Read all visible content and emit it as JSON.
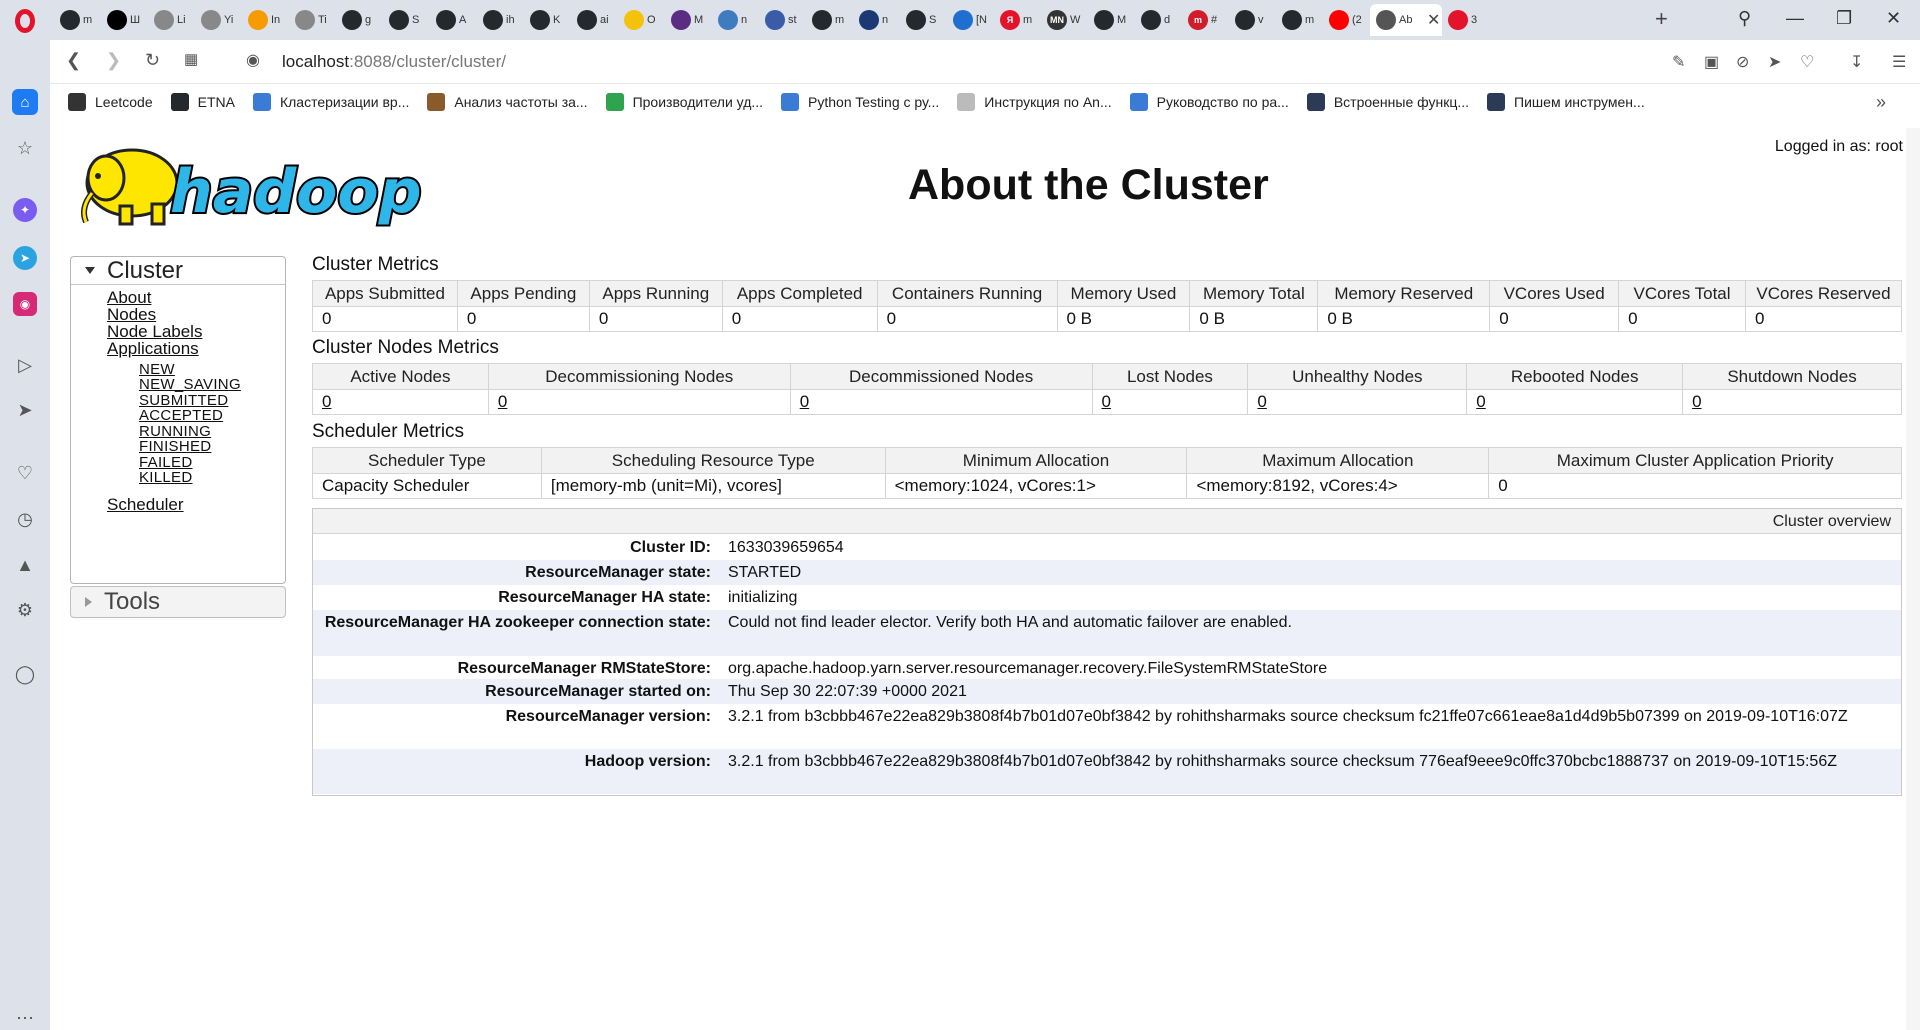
{
  "browser": {
    "tabs": [
      {
        "label": "m",
        "color": "#24292e",
        "glyph": ""
      },
      {
        "label": "Ш",
        "color": "#000000",
        "glyph": ""
      },
      {
        "label": "Li",
        "color": "#888888",
        "glyph": ""
      },
      {
        "label": "Yi",
        "color": "#888888",
        "glyph": ""
      },
      {
        "label": "In",
        "color": "#f59d00",
        "glyph": ""
      },
      {
        "label": "Ti",
        "color": "#888888",
        "glyph": ""
      },
      {
        "label": "g",
        "color": "#24292e",
        "glyph": ""
      },
      {
        "label": "S",
        "color": "#24292e",
        "glyph": ""
      },
      {
        "label": "A",
        "color": "#24292e",
        "glyph": ""
      },
      {
        "label": "ih",
        "color": "#24292e",
        "glyph": ""
      },
      {
        "label": "K",
        "color": "#24292e",
        "glyph": ""
      },
      {
        "label": "ai",
        "color": "#24292e",
        "glyph": ""
      },
      {
        "label": "O",
        "color": "#f4c20d",
        "glyph": ""
      },
      {
        "label": "M",
        "color": "#5b2d82",
        "glyph": ""
      },
      {
        "label": "n",
        "color": "#3f7cbf",
        "glyph": ""
      },
      {
        "label": "st",
        "color": "#3a5ca8",
        "glyph": ""
      },
      {
        "label": "m",
        "color": "#24292e",
        "glyph": ""
      },
      {
        "label": "n",
        "color": "#1b3a73",
        "glyph": ""
      },
      {
        "label": "S",
        "color": "#24292e",
        "glyph": ""
      },
      {
        "label": "[N",
        "color": "#1f6fd1",
        "glyph": ""
      },
      {
        "label": "m",
        "color": "#e3132b",
        "glyph": "Я"
      },
      {
        "label": "W",
        "color": "#333333",
        "glyph": "MN"
      },
      {
        "label": "M",
        "color": "#24292e",
        "glyph": ""
      },
      {
        "label": "d",
        "color": "#24292e",
        "glyph": ""
      },
      {
        "label": "#",
        "color": "#d31c2b",
        "glyph": "m"
      },
      {
        "label": "v",
        "color": "#24292e",
        "glyph": ""
      },
      {
        "label": "m",
        "color": "#24292e",
        "glyph": ""
      },
      {
        "label": "(2",
        "color": "#ff0000",
        "glyph": ""
      }
    ],
    "active_tab": {
      "label": "Ab",
      "color": "#555555"
    },
    "extra_tab": {
      "label": "3",
      "color": "#e3132b"
    },
    "url_host": "localhost",
    "url_path": ":8088/cluster/cluster/",
    "bookmarks": [
      {
        "label": "Leetcode",
        "color": "#333333"
      },
      {
        "label": "ETNA",
        "color": "#24292e"
      },
      {
        "label": "Кластеризации вр...",
        "color": "#3a7bd5"
      },
      {
        "label": "Анализ частоты за...",
        "color": "#8a5a2b"
      },
      {
        "label": "Производители уд...",
        "color": "#2ea44f"
      },
      {
        "label": "Python Testing с ру...",
        "color": "#3a7bd5"
      },
      {
        "label": "Инструкция по An...",
        "color": "#bbbbbb"
      },
      {
        "label": "Руководство по ра...",
        "color": "#3a7bd5"
      },
      {
        "label": "Встроенные функц...",
        "color": "#2b3a55"
      },
      {
        "label": "Пишем инструмен...",
        "color": "#2b3a55"
      }
    ]
  },
  "page": {
    "title": "About the Cluster",
    "logo_text": "hadoop",
    "logged_in": "Logged in as: root",
    "nav": {
      "cluster_header": "Cluster",
      "links": [
        "About",
        "Nodes",
        "Node Labels",
        "Applications"
      ],
      "app_states": [
        "NEW",
        "NEW_SAVING",
        "SUBMITTED",
        "ACCEPTED",
        "RUNNING",
        "FINISHED",
        "FAILED",
        "KILLED"
      ],
      "scheduler": "Scheduler",
      "tools_header": "Tools"
    },
    "cluster_metrics": {
      "title": "Cluster Metrics",
      "headers": [
        "Apps Submitted",
        "Apps Pending",
        "Apps Running",
        "Apps Completed",
        "Containers Running",
        "Memory Used",
        "Memory Total",
        "Memory Reserved",
        "VCores Used",
        "VCores Total",
        "VCores Reserved"
      ],
      "values": [
        "0",
        "0",
        "0",
        "0",
        "0",
        "0 B",
        "0 B",
        "0 B",
        "0",
        "0",
        "0"
      ]
    },
    "node_metrics": {
      "title": "Cluster Nodes Metrics",
      "headers": [
        "Active Nodes",
        "Decommissioning Nodes",
        "Decommissioned Nodes",
        "Lost Nodes",
        "Unhealthy Nodes",
        "Rebooted Nodes",
        "Shutdown Nodes"
      ],
      "values": [
        "0",
        "0",
        "0",
        "0",
        "0",
        "0",
        "0"
      ]
    },
    "scheduler_metrics": {
      "title": "Scheduler Metrics",
      "headers": [
        "Scheduler Type",
        "Scheduling Resource Type",
        "Minimum Allocation",
        "Maximum Allocation",
        "Maximum Cluster Application Priority"
      ],
      "values": [
        "Capacity Scheduler",
        "[memory-mb (unit=Mi), vcores]",
        "<memory:1024, vCores:1>",
        "<memory:8192, vCores:4>",
        "0"
      ]
    },
    "overview": {
      "header": "Cluster overview",
      "rows": [
        {
          "label": "Cluster ID:",
          "value": "1633039659654"
        },
        {
          "label": "ResourceManager state:",
          "value": "STARTED"
        },
        {
          "label": "ResourceManager HA state:",
          "value": "initializing"
        },
        {
          "label": "ResourceManager HA zookeeper connection state:",
          "value": "Could not find leader elector. Verify both HA and automatic failover are enabled."
        },
        {
          "label": "ResourceManager RMStateStore:",
          "value": "org.apache.hadoop.yarn.server.resourcemanager.recovery.FileSystemRMStateStore"
        },
        {
          "label": "ResourceManager started on:",
          "value": "Thu Sep 30 22:07:39 +0000 2021"
        },
        {
          "label": "ResourceManager version:",
          "value": "3.2.1 from b3cbbb467e22ea829b3808f4b7b01d07e0bf3842 by rohithsharmaks source checksum fc21ffe07c661eae8a1d4d9b5b07399 on 2019-09-10T16:07Z"
        },
        {
          "label": "Hadoop version:",
          "value": "3.2.1 from b3cbbb467e22ea829b3808f4b7b01d07e0bf3842 by rohithsharmaks source checksum 776eaf9eee9c0ffc370bcbc1888737 on 2019-09-10T15:56Z"
        }
      ]
    }
  }
}
